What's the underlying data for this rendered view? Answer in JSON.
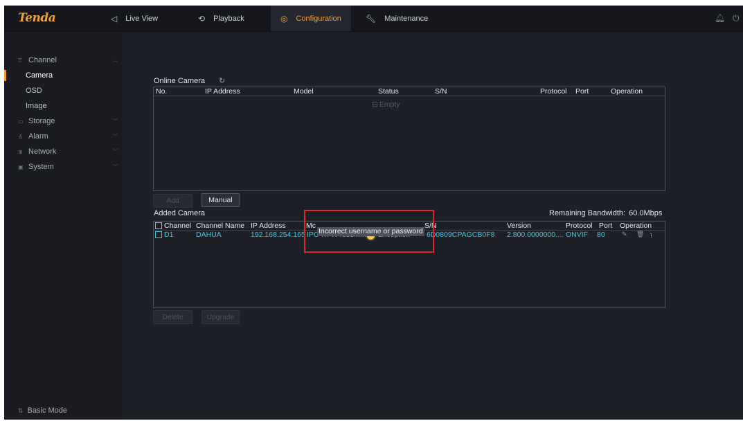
{
  "brand": {
    "logo": "Tenda"
  },
  "nav": [
    {
      "id": "live",
      "icon": "live-view-icon",
      "label": "Live View",
      "active": false
    },
    {
      "id": "playback",
      "icon": "playback-icon",
      "label": "Playback",
      "active": false
    },
    {
      "id": "config",
      "icon": "configuration-icon",
      "label": "Configuration",
      "active": true
    },
    {
      "id": "maint",
      "icon": "maintenance-icon",
      "label": "Maintenance",
      "active": false
    }
  ],
  "sidebar": {
    "groups": [
      {
        "label": "Channel",
        "expanded": true,
        "children": [
          "Camera",
          "OSD",
          "Image"
        ]
      },
      {
        "label": "Storage",
        "expanded": false
      },
      {
        "label": "Alarm",
        "expanded": false
      },
      {
        "label": "Network",
        "expanded": false
      },
      {
        "label": "System",
        "expanded": false
      }
    ],
    "active_child": "Camera",
    "basic_mode": "Basic Mode"
  },
  "online_camera": {
    "title": "Online Camera",
    "columns": [
      "No.",
      "IP Address",
      "Model",
      "Status",
      "S/N",
      "Protocol",
      "Port",
      "Operation"
    ],
    "empty_text": "Empty",
    "add_label": "Add",
    "manual_label": "Manual"
  },
  "added_camera": {
    "title": "Added Camera",
    "bandwidth_label": "Remaining Bandwidth:",
    "bandwidth_value": "60.0Mbps",
    "columns": [
      "Channel",
      "Channel Name",
      "IP Address",
      "Mc",
      "S/N",
      "Version",
      "Protocol",
      "Port",
      "Operation"
    ],
    "rows": [
      {
        "channel": "D1",
        "name": "DAHUA",
        "ip": "192.168.254.165",
        "model": "IPC-HFW4833M...",
        "status": "Exception",
        "sn": "6D0809CPAGCB0F8",
        "version": "2.800.0000000....",
        "protocol": "ONVIF",
        "port": "80"
      }
    ],
    "tooltip": "Incorrect username or password",
    "delete_label": "Delete",
    "upgrade_label": "Upgrade"
  },
  "colors": {
    "accent": "#f0a13c",
    "cyan_text": "#3ec8e0",
    "annotation_red": "#e0252b",
    "warning": "#f5c24a"
  }
}
